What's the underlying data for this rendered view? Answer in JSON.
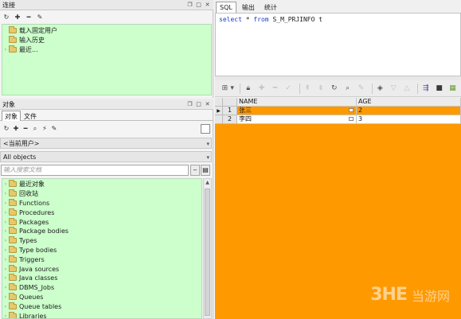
{
  "connections": {
    "title": "连接",
    "items": [
      "载入固定用户",
      "输入历史",
      "最近..."
    ]
  },
  "objects": {
    "title": "对象",
    "tabs": [
      "对象",
      "文件"
    ],
    "user_select": "<当前用户>",
    "type_select": "All objects",
    "search_placeholder": "输入搜索文档",
    "tree": [
      "最近对象",
      "回收站",
      "Functions",
      "Procedures",
      "Packages",
      "Package bodies",
      "Types",
      "Type bodies",
      "Triggers",
      "Java sources",
      "Java classes",
      "DBMS_Jobs",
      "Queues",
      "Queue tables",
      "Libraries"
    ]
  },
  "editor": {
    "tabs": [
      "SQL",
      "输出",
      "统计"
    ],
    "sql_keyword_1": "select",
    "sql_middle": " * ",
    "sql_keyword_2": "from",
    "sql_rest": " S_M_PRJINFO t"
  },
  "grid": {
    "columns": [
      "NAME",
      "AGE"
    ],
    "rows": [
      {
        "num": "1",
        "name": "张三",
        "age": "2"
      },
      {
        "num": "2",
        "name": "李四",
        "age": "3"
      }
    ]
  },
  "watermark": {
    "logo": "3HE",
    "text": "当游网"
  },
  "colors": {
    "tree_bg": "#ccffcc",
    "grid_bg": "#ff9900"
  }
}
